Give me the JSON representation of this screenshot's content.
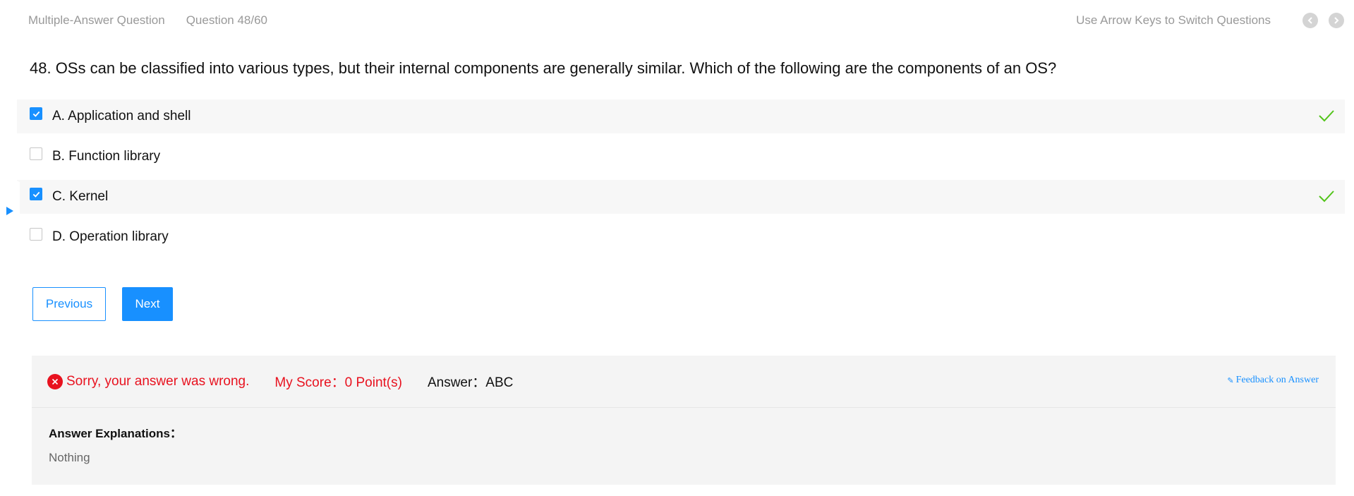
{
  "header": {
    "question_type": "Multiple-Answer Question",
    "question_counter": "Question 48/60",
    "hint": "Use Arrow Keys to Switch Questions"
  },
  "question": {
    "text": "48. OSs can be classified into various types, but their internal components are generally similar. Which of the following are the components of an OS?"
  },
  "options": [
    {
      "label": "A. Application and shell",
      "checked": true,
      "correct": true
    },
    {
      "label": "B. Function library",
      "checked": false,
      "correct": false
    },
    {
      "label": "C. Kernel",
      "checked": true,
      "correct": true
    },
    {
      "label": "D. Operation library",
      "checked": false,
      "correct": false
    }
  ],
  "buttons": {
    "previous": "Previous",
    "next": "Next"
  },
  "result": {
    "status": "Sorry, your answer was wrong.",
    "score": "My Score：0 Point(s)",
    "answer": "Answer：ABC",
    "feedback": "Feedback on Answer",
    "explanation_title": "Answer Explanations：",
    "explanation_body": "Nothing"
  },
  "colors": {
    "accent": "#1890ff",
    "error": "#e8121f",
    "correct": "#52c41a"
  },
  "icons": {
    "prev_arrow": "chevron-left-icon",
    "next_arrow": "chevron-right-icon",
    "check": "checkmark-icon",
    "wrong": "close-circle-icon",
    "feedback": "edit-icon",
    "side_toggle": "caret-right-icon"
  }
}
